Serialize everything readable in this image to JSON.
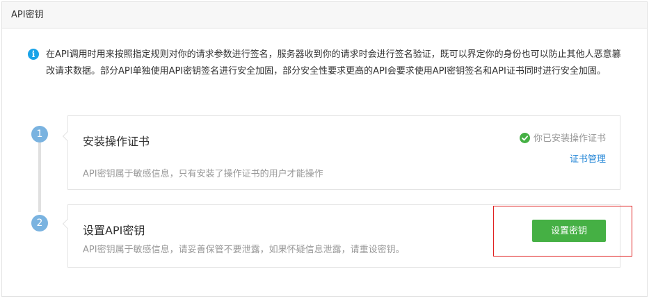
{
  "header": {
    "title": "API密钥"
  },
  "notice": {
    "icon": "info-icon",
    "icon_glyph": "i",
    "text": "在API调用时用来按照指定规则对你的请求参数进行签名，服务器收到你的请求时会进行签名验证，既可以界定你的身份也可以防止其他人恶意篡改请求数据。部分API单独使用API密钥签名进行安全加固，部分安全性要求更高的API会要求使用API密钥签名和API证书同时进行安全加固。"
  },
  "steps": [
    {
      "number": "1",
      "title": "安装操作证书",
      "description": "API密钥属于敏感信息，只有安装了操作证书的用户才能操作",
      "status_text": "你已安装操作证书",
      "status_icon": "check-circle-icon",
      "link_text": "证书管理"
    },
    {
      "number": "2",
      "title": "设置API密钥",
      "description": "API密钥属于敏感信息，请妥善保管不要泄露，如果怀疑信息泄露，请重设密钥。",
      "button_label": "设置密钥"
    }
  ],
  "colors": {
    "accent_green": "#45b044",
    "link_blue": "#2b8ad8",
    "info_blue": "#1aa3e8",
    "step_blue": "#7ab3e0",
    "highlight_red": "#e02020"
  }
}
